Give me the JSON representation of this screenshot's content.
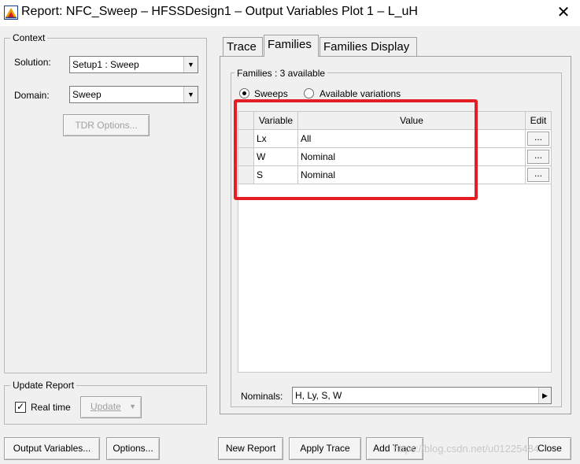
{
  "window": {
    "title": "Report: NFC_Sweep – HFSSDesign1 – Output Variables Plot 1 – L_uH",
    "close_glyph": "✕"
  },
  "context": {
    "legend": "Context",
    "solution_label": "Solution:",
    "solution_value": "Setup1 : Sweep",
    "domain_label": "Domain:",
    "domain_value": "Sweep",
    "tdr_button": "TDR Options..."
  },
  "update_report": {
    "legend": "Update Report",
    "realtime_label": "Real time",
    "realtime_checked": true,
    "update_button": "Update"
  },
  "tabs": [
    {
      "label": "Trace",
      "active": false
    },
    {
      "label": "Families",
      "active": true
    },
    {
      "label": "Families Display",
      "active": false
    }
  ],
  "families": {
    "legend": "Families : 3 available",
    "radio_sweeps": "Sweeps",
    "radio_variations": "Available variations",
    "selected_radio": "Sweeps",
    "grid_headers": {
      "variable": "Variable",
      "value": "Value",
      "edit": "Edit"
    },
    "rows": [
      {
        "variable": "Lx",
        "value": "All",
        "edit": "..."
      },
      {
        "variable": "W",
        "value": "Nominal",
        "edit": "..."
      },
      {
        "variable": "S",
        "value": "Nominal",
        "edit": "..."
      }
    ],
    "nominals_label": "Nominals:",
    "nominals_value": "H, Ly, S, W"
  },
  "bottom_buttons": {
    "output_variables": "Output Variables...",
    "options": "Options...",
    "new_report": "New Report",
    "apply_trace": "Apply Trace",
    "add_trace": "Add Trace",
    "close": "Close"
  },
  "watermark": "https://blog.csdn.net/u01225484",
  "colors": {
    "highlight": "#e51e25",
    "window_bg": "#f0f0f0"
  },
  "icons": {
    "app": "hfss-report-icon",
    "dropdown": "chevron-down-icon",
    "nominals_expand": "chevron-right-icon",
    "check": "checkmark-icon"
  }
}
